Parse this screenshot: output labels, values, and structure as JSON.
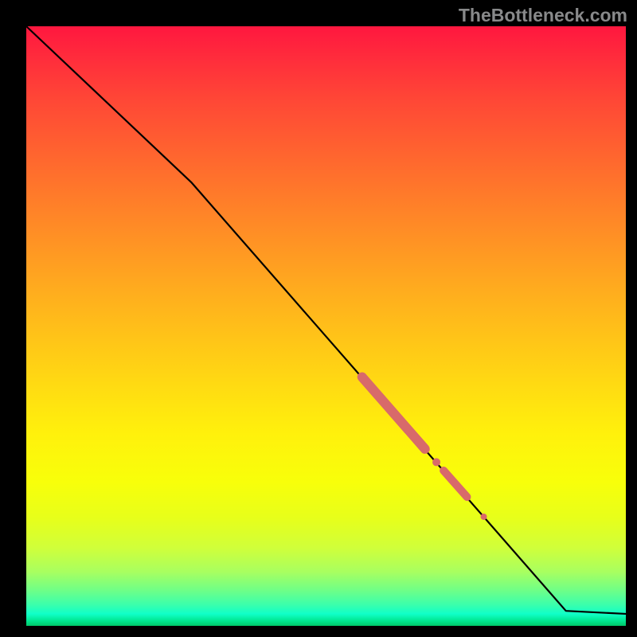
{
  "watermark": "TheBottleneck.com",
  "colors": {
    "curve_stroke": "#000000",
    "highlight_stroke": "#d86a6a",
    "gradient_top": "#ff173f",
    "gradient_bottom": "#00c86a",
    "frame_bg": "#000000"
  },
  "chart_data": {
    "type": "line",
    "title": "",
    "xlabel": "",
    "ylabel": "",
    "xlim": [
      0,
      100
    ],
    "ylim": [
      0,
      100
    ],
    "grid": false,
    "legend": false,
    "series": [
      {
        "name": "curve",
        "x": [
          0,
          27.5,
          90,
          100
        ],
        "y": [
          100,
          74,
          2.5,
          2.0
        ],
        "style": "line",
        "color": "#000000",
        "width": 2
      },
      {
        "name": "highlight-segment-1",
        "x": [
          56,
          66.5
        ],
        "y": [
          41.5,
          29.5
        ],
        "style": "line",
        "color": "#d86a6a",
        "width": 9
      },
      {
        "name": "highlight-dot-1",
        "x": [
          68.4
        ],
        "y": [
          27.3
        ],
        "style": "scatter",
        "color": "#d86a6a",
        "size": 9
      },
      {
        "name": "highlight-segment-2",
        "x": [
          69.6,
          73.5
        ],
        "y": [
          25.9,
          21.5
        ],
        "style": "line",
        "color": "#d86a6a",
        "width": 8
      },
      {
        "name": "highlight-dot-2",
        "x": [
          76.3
        ],
        "y": [
          18.2
        ],
        "style": "scatter",
        "color": "#d86a6a",
        "size": 7
      }
    ]
  }
}
